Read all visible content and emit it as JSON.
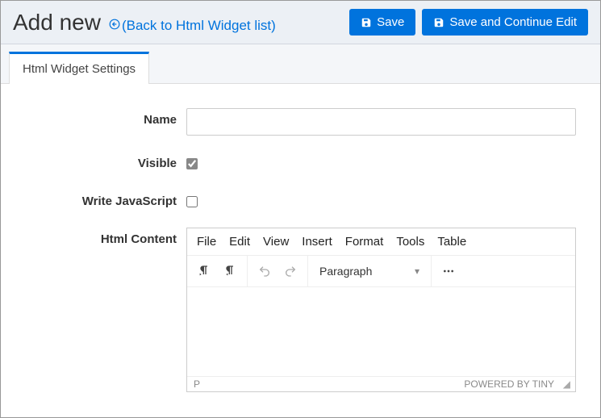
{
  "header": {
    "title": "Add new",
    "back_link": "(Back to Html Widget list)",
    "save_label": "Save",
    "save_continue_label": "Save and Continue Edit"
  },
  "tabs": {
    "settings_label": "Html Widget Settings"
  },
  "form": {
    "name_label": "Name",
    "name_value": "",
    "visible_label": "Visible",
    "visible_checked": true,
    "write_js_label": "Write JavaScript",
    "write_js_checked": false,
    "html_content_label": "Html Content"
  },
  "editor": {
    "menu": {
      "file": "File",
      "edit": "Edit",
      "view": "View",
      "insert": "Insert",
      "format": "Format",
      "tools": "Tools",
      "table": "Table"
    },
    "format_selected": "Paragraph",
    "status_path": "P",
    "powered_by": "POWERED BY TINY"
  }
}
